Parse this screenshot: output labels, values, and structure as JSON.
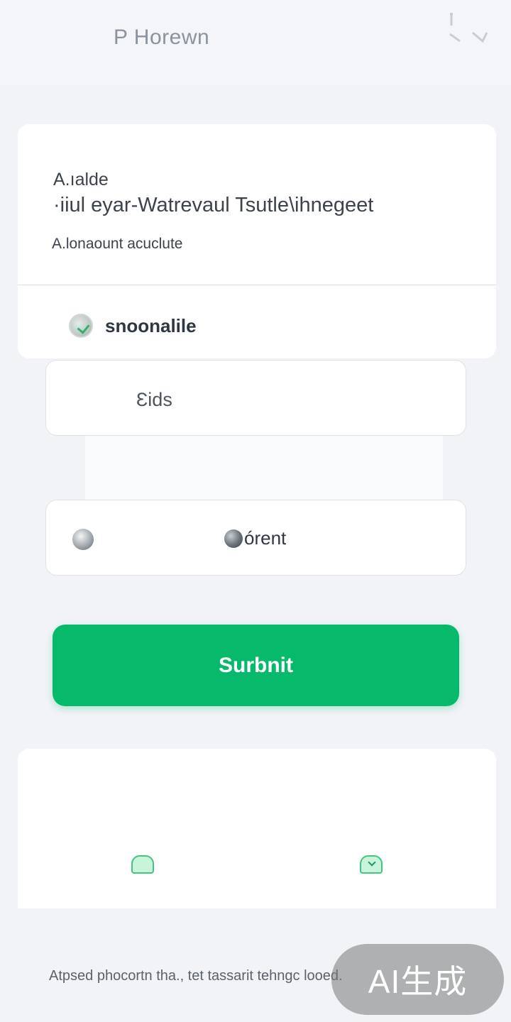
{
  "header": {
    "title": "P Horewn",
    "corner_icon": "chevron-down-icon"
  },
  "intro_card": {
    "line1": "A.ıalde",
    "line2": "·iiul  eyar-Watrevaul  Tsutle\\ihnegeet",
    "line3": "A.lonaount acuclute"
  },
  "profile": {
    "name": "snoonalile",
    "icon": "avatar-icon"
  },
  "fields": {
    "field1_value": "Ɛids",
    "field2_value": "órent",
    "field2_left_icon": "avatar-icon",
    "field2_value_icon": "avatar-icon"
  },
  "submit": {
    "label": "Surbnit"
  },
  "bottom_nav": {
    "icon1": "home-icon",
    "icon2": "download-icon"
  },
  "footer": {
    "text": "Atpsed phocortn tha., tet tassarit tehngc looed."
  },
  "watermark": {
    "text": "AI生成"
  },
  "colors": {
    "accent": "#06b96b",
    "background": "#f1f3f7",
    "card": "#ffffff"
  }
}
